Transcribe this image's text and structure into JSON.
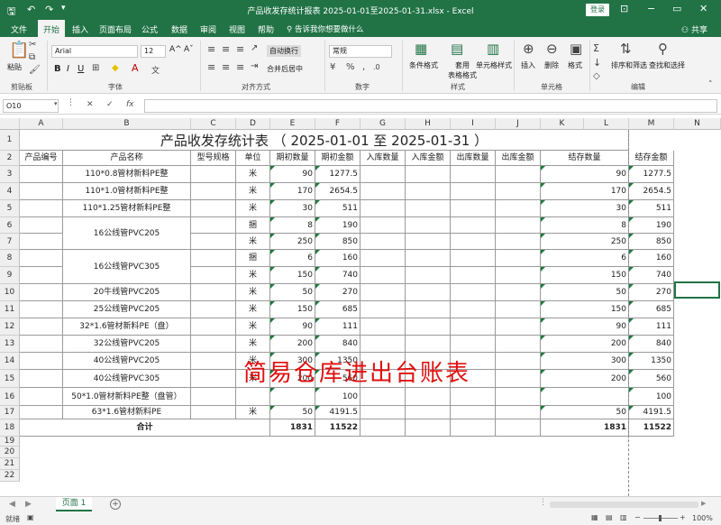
{
  "window": {
    "doc_title": "产品收发存统计报表 2025-01-01至2025-01-31.xlsx  -  Excel",
    "login": "登录",
    "minimize": "−",
    "restore": "▭",
    "close": "✕",
    "ribbon_toggle": "⊡"
  },
  "ribbon_tabs": [
    "文件",
    "开始",
    "插入",
    "页面布局",
    "公式",
    "数据",
    "审阅",
    "视图",
    "帮助"
  ],
  "tell_me": "告诉我你想要做什么",
  "share": "共享",
  "ribbon": {
    "paste": "粘贴",
    "clipboard_group": "剪贴板",
    "font_name": "Arial",
    "font_size": "12",
    "font_group": "字体",
    "bold": "B",
    "italic": "I",
    "underline": "U",
    "wrap": "自动换行",
    "merge": "合并后居中",
    "align_group": "对齐方式",
    "number_format": "常规",
    "number_group": "数字",
    "cond_format": "条件格式",
    "table_format": "套用\n表格格式",
    "cell_style": "单元格样式",
    "style_group": "样式",
    "insert": "插入",
    "delete": "删除",
    "format": "格式",
    "cells_group": "单元格",
    "sort_filter": "排序和筛选",
    "find_select": "查找和选择",
    "edit_group": "编辑"
  },
  "formula_bar": {
    "name_box": "O10",
    "cancel": "✕",
    "enter": "✓",
    "fx": "fx",
    "value": ""
  },
  "columns": [
    "A",
    "B",
    "C",
    "D",
    "E",
    "F",
    "G",
    "H",
    "I",
    "J",
    "K",
    "L",
    "M",
    "N",
    "O"
  ],
  "sheet": {
    "title": "产品收发存统计表  （ 2025-01-01  至  2025-01-31 ）",
    "headers": [
      "产品编号",
      "产品名称",
      "型号规格",
      "单位",
      "期初数量",
      "期初金额",
      "入库数量",
      "入库金额",
      "出库数量",
      "出库金额",
      "结存数量",
      "结存金额"
    ],
    "rows": [
      {
        "name": "110*0.8管材新料PE整",
        "unit": "米",
        "qty": "90",
        "amt": "1277.5",
        "bq": "90",
        "ba": "1277.5"
      },
      {
        "name": "110*1.0管材新料PE整",
        "unit": "米",
        "qty": "170",
        "amt": "2654.5",
        "bq": "170",
        "ba": "2654.5"
      },
      {
        "name": "110*1.25管材新料PE整",
        "unit": "米",
        "qty": "30",
        "amt": "511",
        "bq": "30",
        "ba": "511"
      },
      {
        "name": "16公线管PVC205",
        "unit": "捆",
        "qty": "8",
        "amt": "190",
        "bq": "8",
        "ba": "190"
      },
      {
        "name": "",
        "unit": "米",
        "qty": "250",
        "amt": "850",
        "bq": "250",
        "ba": "850"
      },
      {
        "name": "16公线管PVC305",
        "unit": "捆",
        "qty": "6",
        "amt": "160",
        "bq": "6",
        "ba": "160"
      },
      {
        "name": "",
        "unit": "米",
        "qty": "150",
        "amt": "740",
        "bq": "150",
        "ba": "740"
      },
      {
        "name": "20牛线管PVC205",
        "unit": "米",
        "qty": "50",
        "amt": "270",
        "bq": "50",
        "ba": "270"
      },
      {
        "name": "25公线管PVC205",
        "unit": "米",
        "qty": "150",
        "amt": "685",
        "bq": "150",
        "ba": "685"
      },
      {
        "name": "32*1.6管材新料PE（盘）",
        "unit": "米",
        "qty": "90",
        "amt": "111",
        "bq": "90",
        "ba": "111"
      },
      {
        "name": "32公线管PVC205",
        "unit": "米",
        "qty": "200",
        "amt": "840",
        "bq": "200",
        "ba": "840"
      },
      {
        "name": "40公线管PVC205",
        "unit": "米",
        "qty": "300",
        "amt": "1350",
        "bq": "300",
        "ba": "1350"
      },
      {
        "name": "40公线管PVC305",
        "unit": "米",
        "qty": "200",
        "amt": "560",
        "bq": "200",
        "ba": "560"
      },
      {
        "name": "50*1.0管材新料PE整（盘管）",
        "unit": "",
        "qty": "",
        "amt": "100",
        "bq": "",
        "ba": "100"
      },
      {
        "name": "63*1.6管材新料PE",
        "unit": "米",
        "qty": "50",
        "amt": "4191.5",
        "bq": "50",
        "ba": "4191.5"
      }
    ],
    "total": {
      "label": "合计",
      "qty": "1831",
      "amt": "11522",
      "bq": "1831",
      "ba": "11522"
    },
    "row_numbers": [
      "1",
      "2",
      "3",
      "4",
      "5",
      "6",
      "7",
      "8",
      "9",
      "10",
      "11",
      "12",
      "13",
      "14",
      "15",
      "16",
      "17",
      "18",
      "19",
      "20",
      "21",
      "22"
    ]
  },
  "watermark": "简易仓库进出台账表",
  "sheet_tab": "页面 1",
  "status": {
    "ready": "就绪",
    "zoom": "100%",
    "minus": "−",
    "plus": "+"
  }
}
